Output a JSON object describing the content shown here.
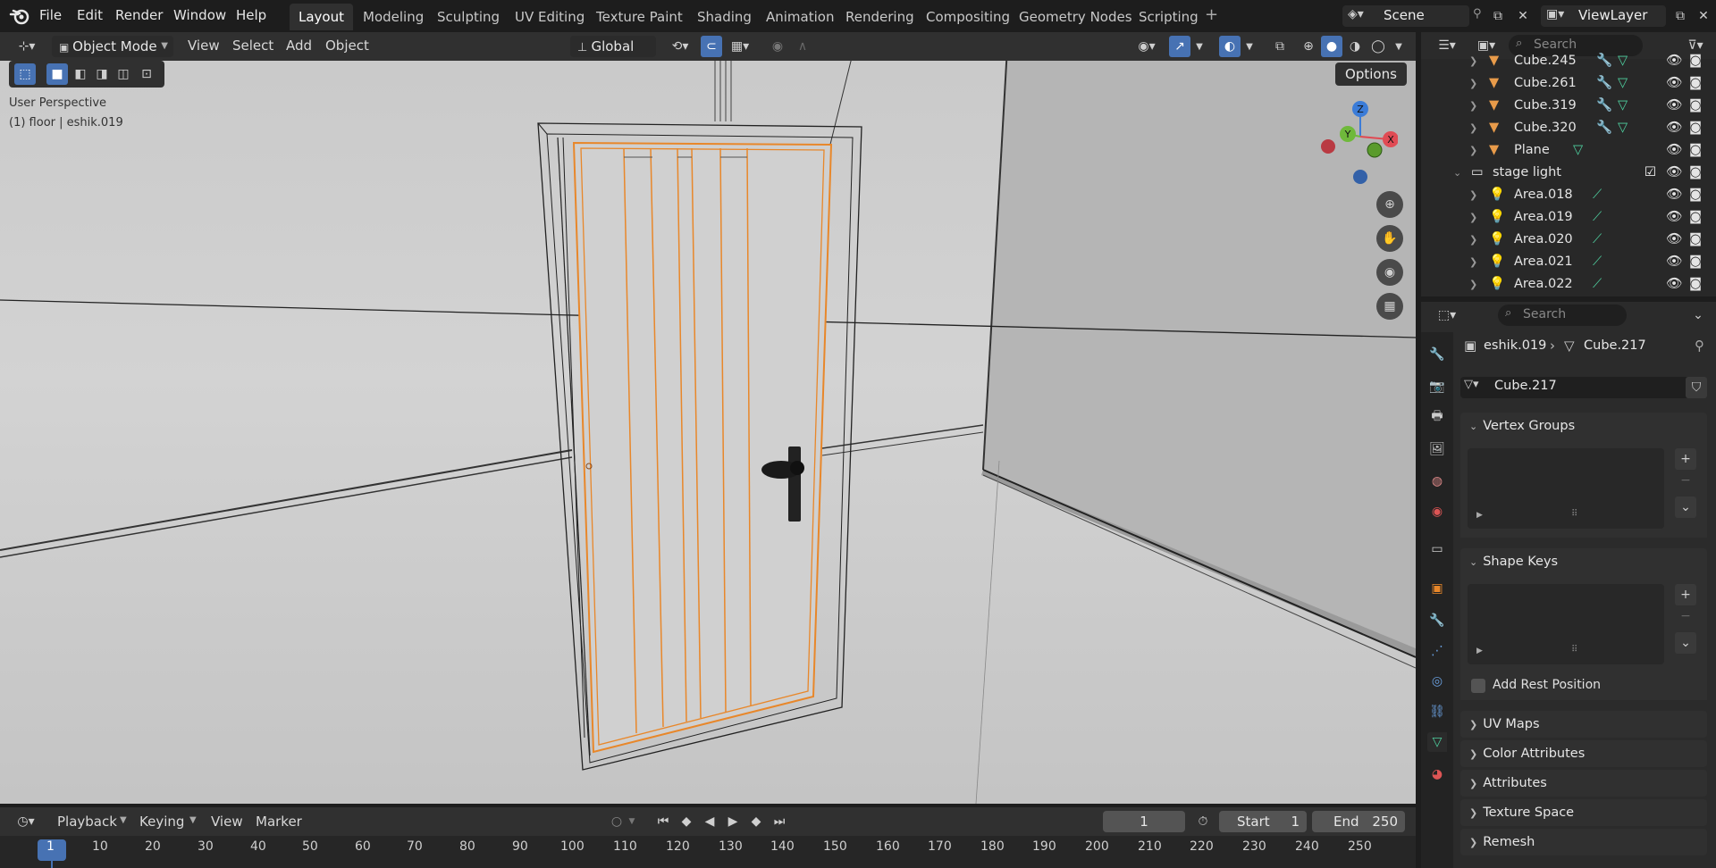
{
  "menu": [
    "File",
    "Edit",
    "Render",
    "Window",
    "Help"
  ],
  "workspaces": [
    "Layout",
    "Modeling",
    "Sculpting",
    "UV Editing",
    "Texture Paint",
    "Shading",
    "Animation",
    "Rendering",
    "Compositing",
    "Geometry Nodes",
    "Scripting"
  ],
  "active_workspace": "Layout",
  "scene_name": "Scene",
  "view_layer_name": "ViewLayer",
  "viewport": {
    "mode": "Object Mode",
    "menus": [
      "View",
      "Select",
      "Add",
      "Object"
    ],
    "orientation": "Global",
    "options_label": "Options",
    "overlay_line1": "User Perspective",
    "overlay_line2": "(1) floor | eshik.019",
    "gizmo_axes": [
      "Z",
      "Y",
      "X"
    ]
  },
  "outliner": {
    "search_placeholder": "Search",
    "items": [
      {
        "name": "Cube.245",
        "type": "mesh"
      },
      {
        "name": "Cube.261",
        "type": "mesh"
      },
      {
        "name": "Cube.319",
        "type": "mesh"
      },
      {
        "name": "Cube.320",
        "type": "mesh"
      },
      {
        "name": "Plane",
        "type": "mesh"
      },
      {
        "name": "stage light",
        "type": "collection"
      },
      {
        "name": "Area.018",
        "type": "light"
      },
      {
        "name": "Area.019",
        "type": "light"
      },
      {
        "name": "Area.020",
        "type": "light"
      },
      {
        "name": "Area.021",
        "type": "light"
      },
      {
        "name": "Area.022",
        "type": "light"
      }
    ]
  },
  "properties": {
    "search_placeholder": "Search",
    "breadcrumb_object": "eshik.019",
    "breadcrumb_data": "Cube.217",
    "data_name": "Cube.217",
    "panels": {
      "vertex_groups": "Vertex Groups",
      "shape_keys": "Shape Keys",
      "add_rest_position": "Add Rest Position",
      "uv_maps": "UV Maps",
      "color_attributes": "Color Attributes",
      "attributes": "Attributes",
      "texture_space": "Texture Space",
      "remesh": "Remesh"
    }
  },
  "timeline": {
    "menus": [
      "Playback",
      "Keying",
      "View",
      "Marker"
    ],
    "current_frame": "1",
    "start_label": "Start",
    "start_value": "1",
    "end_label": "End",
    "end_value": "250",
    "ticks": [
      "1",
      "10",
      "20",
      "30",
      "40",
      "50",
      "60",
      "70",
      "80",
      "90",
      "100",
      "110",
      "120",
      "130",
      "140",
      "150",
      "160",
      "170",
      "180",
      "190",
      "200",
      "210",
      "220",
      "230",
      "240",
      "250"
    ]
  },
  "colors": {
    "accent": "#4772b3",
    "selection_orange": "#e8872a",
    "light_icon": "#e0a36a",
    "mesh_icon": "#e89b4a",
    "data_green": "#4fd1a0"
  }
}
